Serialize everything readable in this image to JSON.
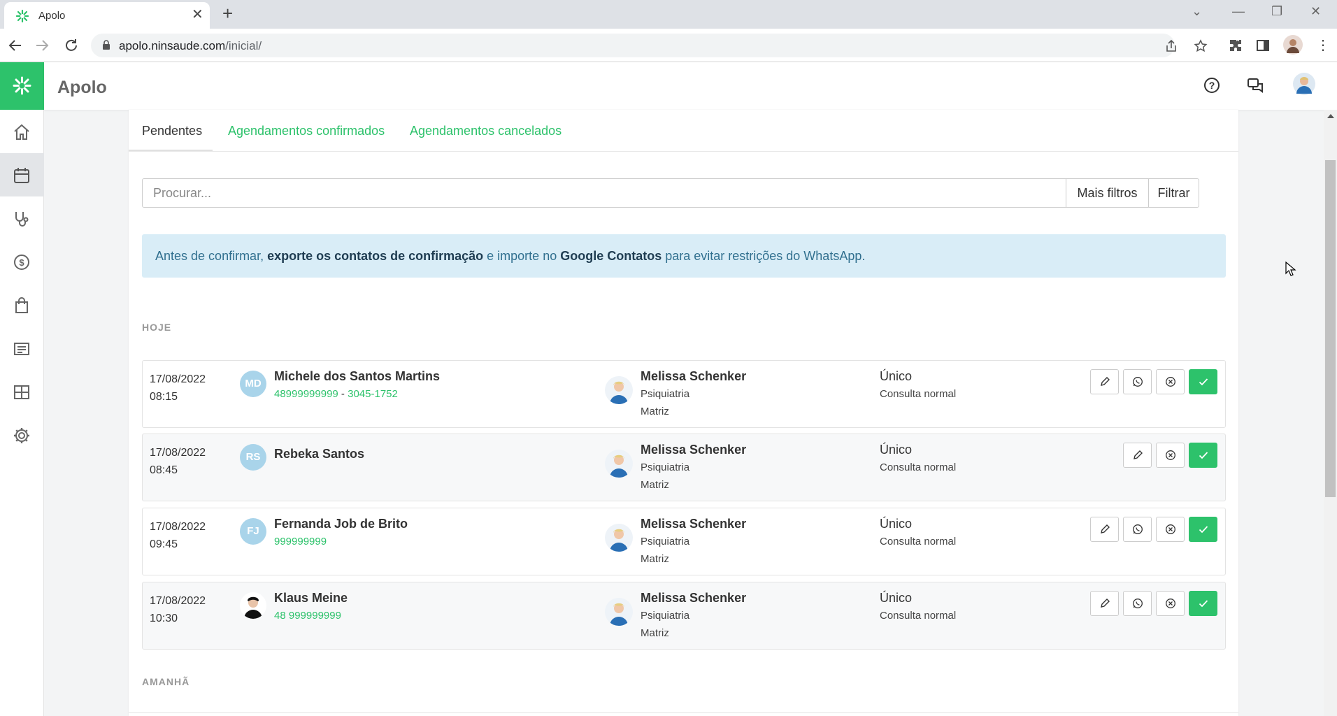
{
  "browser": {
    "tab_title": "Apolo",
    "url_host": "apolo.ninsaude.com",
    "url_path": "/inicial/"
  },
  "app": {
    "title": "Apolo",
    "brand_color": "#2dc26b"
  },
  "tabs": [
    {
      "label": "Pendentes"
    },
    {
      "label": "Agendamentos confirmados"
    },
    {
      "label": "Agendamentos cancelados"
    }
  ],
  "search": {
    "placeholder": "Procurar...",
    "more_filters": "Mais filtros",
    "filter": "Filtrar"
  },
  "alert": {
    "part1": "Antes de confirmar, ",
    "bold1": "exporte os contatos de confirmação",
    "part2": " e importe no ",
    "bold2": "Google Contatos",
    "part3": " para evitar restrições do WhatsApp."
  },
  "sections": {
    "today": "HOJE",
    "tomorrow": "AMANHÃ"
  },
  "appointments": [
    {
      "date": "17/08/2022",
      "time": "08:15",
      "initials": "MD",
      "patient": "Michele dos Santos Martins",
      "phone": "48999999999",
      "phone_sep": " - ",
      "phone2": "3045-1752",
      "doctor": "Melissa Schenker",
      "specialty": "Psiquiatria",
      "unit": "Matriz",
      "type": "Único",
      "kind": "Consulta normal"
    },
    {
      "date": "17/08/2022",
      "time": "08:45",
      "initials": "RS",
      "patient": "Rebeka Santos",
      "doctor": "Melissa Schenker",
      "specialty": "Psiquiatria",
      "unit": "Matriz",
      "type": "Único",
      "kind": "Consulta normal"
    },
    {
      "date": "17/08/2022",
      "time": "09:45",
      "initials": "FJ",
      "patient": "Fernanda Job de Brito",
      "phone": "999999999",
      "doctor": "Melissa Schenker",
      "specialty": "Psiquiatria",
      "unit": "Matriz",
      "type": "Único",
      "kind": "Consulta normal"
    },
    {
      "date": "17/08/2022",
      "time": "10:30",
      "patient": "Klaus Meine",
      "phone": "48 999999999",
      "doctor": "Melissa Schenker",
      "specialty": "Psiquiatria",
      "unit": "Matriz",
      "type": "Único",
      "kind": "Consulta normal"
    }
  ]
}
